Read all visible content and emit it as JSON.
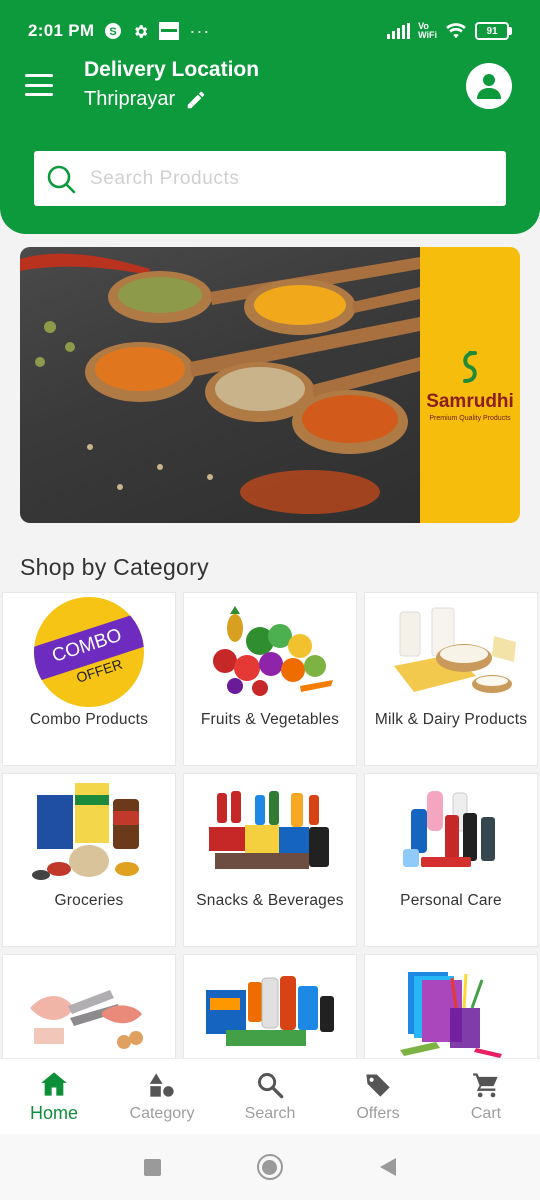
{
  "status_bar": {
    "time": "2:01 PM",
    "battery": "91",
    "volte": "Vo",
    "wifi_label": "WiFi"
  },
  "header": {
    "location_title": "Delivery Location",
    "location_value": "Thriprayar"
  },
  "search": {
    "placeholder": "Search Products"
  },
  "banner": {
    "brand_name": "Samrudhi",
    "brand_tagline": "Premium Quality Products",
    "brand_color": "#f6bd0d"
  },
  "section_title": "Shop by Category",
  "categories": [
    {
      "label": "Combo Products",
      "icon": "combo-offer-badge",
      "badge_line1": "COMBO",
      "badge_line2": "OFFER"
    },
    {
      "label": "Fruits & Vegetables",
      "icon": "fruits-vegetables-image"
    },
    {
      "label": "Milk & Dairy Products",
      "icon": "dairy-products-image"
    },
    {
      "label": "Groceries",
      "icon": "groceries-image"
    },
    {
      "label": "Snacks & Beverages",
      "icon": "snacks-beverages-image"
    },
    {
      "label": "Personal Care",
      "icon": "personal-care-image"
    },
    {
      "label": "",
      "icon": "meat-fish-image"
    },
    {
      "label": "",
      "icon": "household-cleaning-image"
    },
    {
      "label": "",
      "icon": "stationery-image"
    }
  ],
  "bottom_nav": [
    {
      "label": "Home",
      "icon": "home-icon",
      "active": true
    },
    {
      "label": "Category",
      "icon": "category-icon",
      "active": false
    },
    {
      "label": "Search",
      "icon": "search-icon",
      "active": false
    },
    {
      "label": "Offers",
      "icon": "offers-tag-icon",
      "active": false
    },
    {
      "label": "Cart",
      "icon": "cart-icon",
      "active": false
    }
  ],
  "colors": {
    "primary": "#0d9a3c",
    "active_nav": "#0d8f39",
    "inactive_nav": "#9e9e9e"
  }
}
